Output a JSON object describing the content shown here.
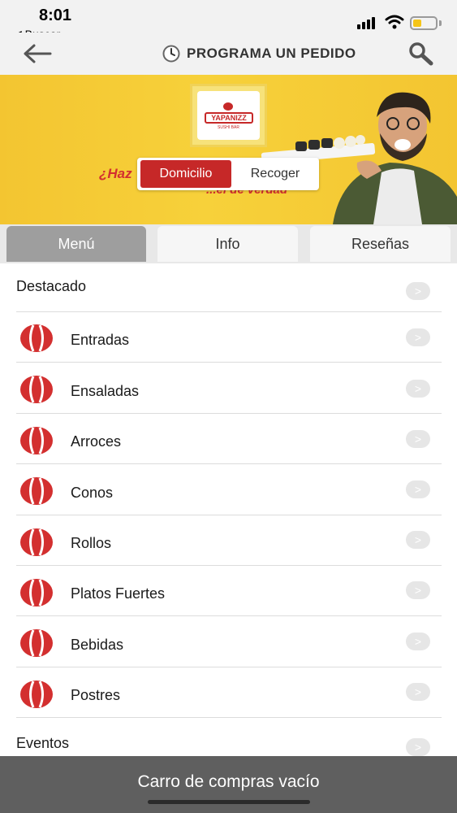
{
  "status_bar": {
    "time": "8:01",
    "back_label": "◀ Buscar"
  },
  "header": {
    "title": "PROGRAMA UN PEDIDO",
    "back_icon": "back-arrow-icon",
    "search_icon": "search-icon",
    "clock_icon": "clock-icon"
  },
  "banner": {
    "logo_text": "YAPANIZZ",
    "logo_subtext": "SUSHI BAR",
    "slogan_line1": "¿Haz",
    "slogan_line2": "...el de verdad",
    "toggle": {
      "active": "Domicilio",
      "inactive": "Recoger"
    }
  },
  "tabs": [
    "Menú",
    "Info",
    "Reseñas"
  ],
  "menu": {
    "destacado": "Destacado",
    "items": [
      "Entradas",
      "Ensaladas",
      "Arroces",
      "Conos",
      "Rollos",
      "Platos Fuertes",
      "Bebidas",
      "Postres"
    ],
    "eventos": "Eventos"
  },
  "cart": {
    "label": "Carro de compras vacío"
  },
  "colors": {
    "accent_red": "#c62828",
    "banner_yellow": "#f3c531",
    "cart_bar": "#5f5f5f"
  }
}
